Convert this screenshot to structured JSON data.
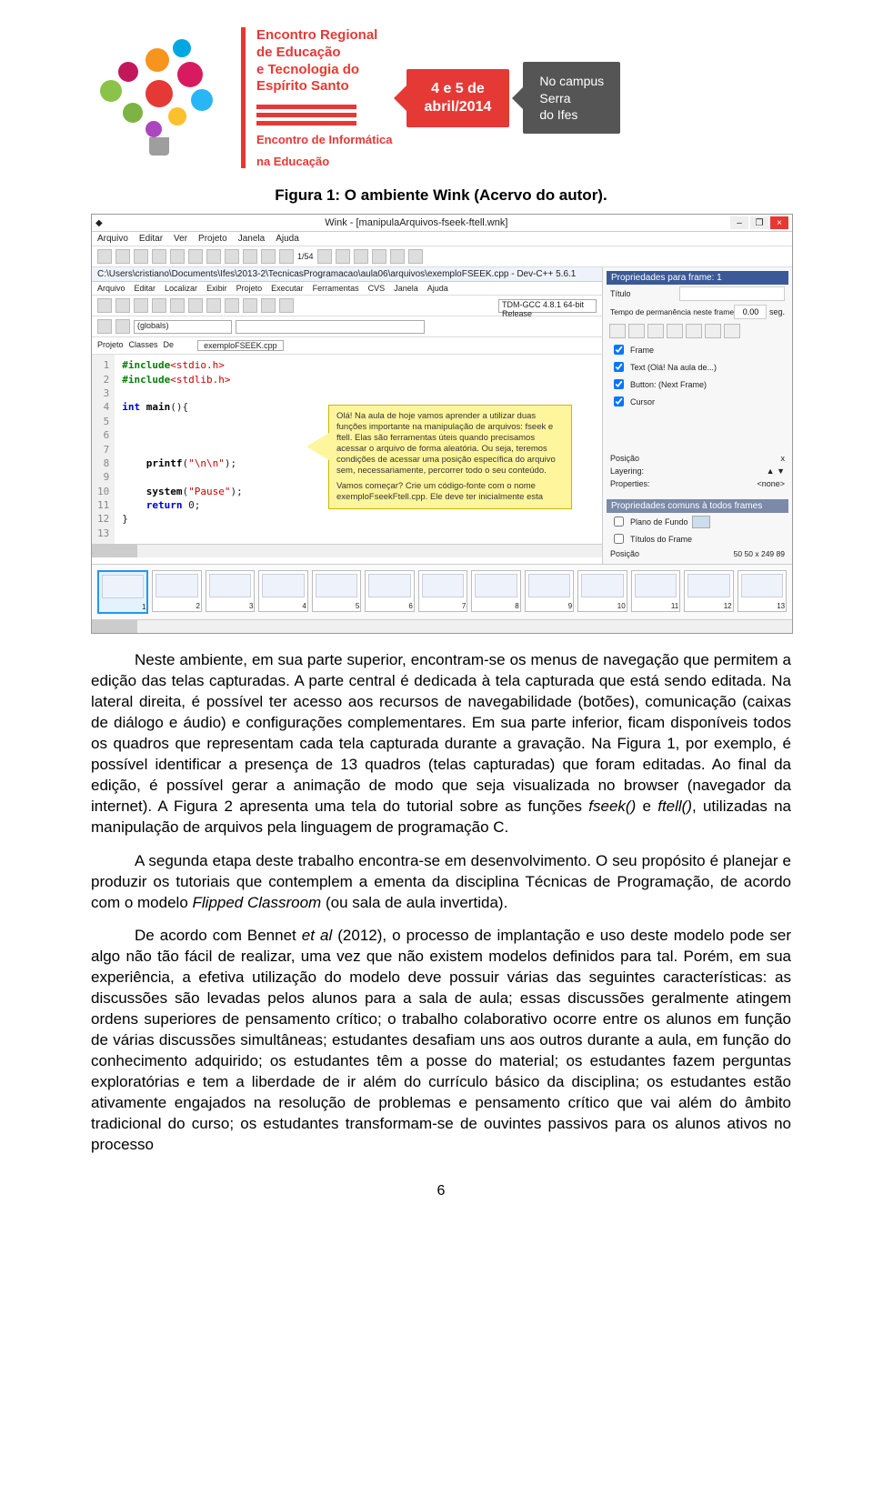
{
  "header": {
    "title_lines": [
      "Encontro Regional",
      "de Educação",
      "e Tecnologia do",
      "Espírito Santo"
    ],
    "subtitle_lines": [
      "Encontro de Informática",
      "na Educação"
    ],
    "date_line1": "4 e 5 de",
    "date_line2": "abril/2014",
    "campus_line1": "No campus",
    "campus_line2": "Serra",
    "campus_line3": "do Ifes"
  },
  "figure_caption": "Figura 1: O ambiente Wink (Acervo do autor).",
  "wink": {
    "window_title": "Wink - [manipulaArquivos-fseek-ftell.wnk]",
    "menus": [
      "Arquivo",
      "Editar",
      "Ver",
      "Projeto",
      "Janela",
      "Ajuda"
    ],
    "nav_info": "1/54",
    "pathbar": "C:\\Users\\cristiano\\Documents\\Ifes\\2013-2\\TecnicasProgramacao\\aula06\\arquivos\\exemploFSEEK.cpp - Dev-C++ 5.6.1",
    "inner_menus": [
      "Arquivo",
      "Editar",
      "Localizar",
      "Exibir",
      "Projeto",
      "Executar",
      "Ferramentas",
      "CVS",
      "Janela",
      "Ajuda"
    ],
    "compiler": "TDM-GCC 4.8.1 64-bit Release",
    "globals": "(globals)",
    "side_tabs": [
      "Projeto",
      "Classes",
      "De"
    ],
    "file_tab": "exemploFSEEK.cpp",
    "line_numbers": [
      "1",
      "2",
      "3",
      "4",
      "5",
      "6",
      "7",
      "8",
      "9",
      "10",
      "11",
      "12",
      "13"
    ],
    "code": {
      "l1a": "#include",
      "l1b": "<stdio.h>",
      "l2a": "#include",
      "l2b": "<stdlib.h>",
      "l4a": "int ",
      "l4b": "main",
      "l4c": "(){",
      "l8a": "printf",
      "l8b": "(",
      "l8c": "\"\\n\\n\"",
      "l8d": ");",
      "l10a": "system",
      "l10b": "(",
      "l10c": "\"Pause\"",
      "l10d": ");",
      "l11a": "return ",
      "l11b": "0",
      "l11c": ";",
      "l12": "}"
    },
    "callout_text1": "Olá! Na aula de hoje vamos aprender a utilizar duas funções importante na manipulação de arquivos: fseek e ftell. Elas são ferramentas úteis quando precisamos acessar o arquivo de forma aleatória. Ou seja, teremos condições de acessar uma posição específica do arquivo sem, necessariamente, percorrer todo o seu conteúdo.",
    "callout_text2": "Vamos começar? Crie um código-fonte com o nome exemploFseekFtell.cpp. Ele deve ter inicialmente esta",
    "props": {
      "panel_title": "Propriedades para frame: 1",
      "titulo_label": "Título",
      "tempo_label": "Tempo de permanência neste frame",
      "tempo_value": "0.00",
      "tempo_unit": "seg.",
      "chk_frame": "Frame",
      "chk_text": "Text (Olá! Na aula de...)",
      "chk_button": "Button: (Next Frame)",
      "chk_cursor": "Cursor",
      "pos_label": "Posição",
      "pos_x": "x",
      "layer_label": "Layering:",
      "props_label": "Properties:",
      "props_value": "<none>",
      "common_title": "Propriedades comuns à todos frames",
      "plano_label": "Plano de Fundo",
      "titulos_label": "Títulos do Frame",
      "posicao_label": "Posição",
      "pos_vals": [
        "50",
        "50",
        "x",
        "249",
        "89"
      ]
    },
    "thumb_labels": [
      "1",
      "2",
      "3",
      "4",
      "5",
      "6",
      "7",
      "8",
      "9",
      "10",
      "11",
      "12",
      "13"
    ]
  },
  "paragraphs": {
    "p1": "Neste ambiente, em sua parte superior, encontram-se os menus de navegação que permitem a edição das telas capturadas. A parte central é dedicada à tela capturada que está sendo editada. Na lateral direita, é possível ter acesso aos recursos de navegabilidade (botões), comunicação (caixas de diálogo e áudio) e configurações complementares. Em sua parte inferior, ficam disponíveis todos os quadros que representam cada tela capturada durante a gravação. Na Figura 1, por exemplo, é possível identificar a presença de 13 quadros (telas capturadas) que foram editadas. Ao final da edição, é possível gerar a animação de modo que seja visualizada no browser (navegador da internet). A Figura 2 apresenta uma tela do tutorial sobre as funções ",
    "p1_em1": "fseek()",
    "p1_mid": " e ",
    "p1_em2": "ftell()",
    "p1_end": ", utilizadas na manipulação de arquivos pela linguagem de programação C.",
    "p2a": "A segunda etapa deste trabalho encontra-se em desenvolvimento. O seu propósito é planejar e produzir os tutoriais que contemplem a ementa da disciplina Técnicas de Programação, de acordo com o modelo ",
    "p2_em1": "Flipped Classroom",
    "p2b": " (ou sala de aula invertida).",
    "p3a": "De acordo com Bennet ",
    "p3_em1": "et al",
    "p3b": " (2012), o processo de implantação e uso deste modelo pode ser algo não tão fácil de realizar, uma vez que não existem modelos definidos para tal. Porém, em sua experiência, a efetiva utilização do modelo deve possuir várias das seguintes características: as discussões são levadas pelos alunos para a sala de aula; essas discussões geralmente atingem ordens superiores de pensamento crítico; o trabalho colaborativo ocorre entre os alunos em função de várias discussões simultâneas; estudantes desafiam uns aos outros durante a aula, em função do conhecimento adquirido; os estudantes têm a posse do material; os estudantes fazem perguntas exploratórias e tem a liberdade de ir além do currículo básico da disciplina; os estudantes estão ativamente engajados na resolução de problemas e pensamento crítico que vai além do âmbito tradicional do curso; os estudantes transformam-se de ouvintes passivos para os alunos ativos no processo"
  },
  "page_number": "6"
}
